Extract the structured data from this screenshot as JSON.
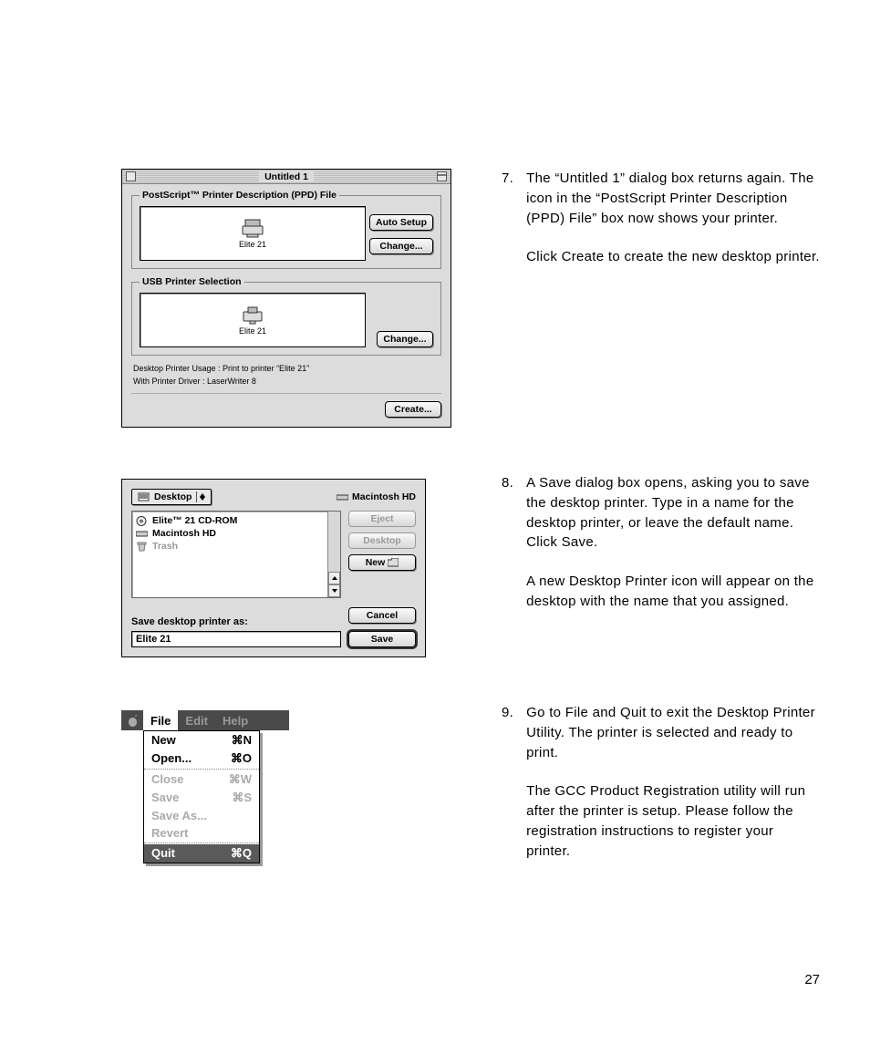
{
  "page_number": "27",
  "steps": [
    {
      "num": "7.",
      "paras": [
        "The “Untitled 1” dialog box returns again. The icon in the “PostScript Printer Description (PPD) File” box now shows your printer.",
        "Click Create to create the new desktop printer."
      ]
    },
    {
      "num": "8.",
      "paras": [
        "A Save dialog box opens, asking you to save the desktop printer. Type in a name for the desktop printer, or leave the default name. Click Save.",
        "A new Desktop Printer icon will appear on the desktop with the name that you assigned."
      ]
    },
    {
      "num": "9.",
      "paras": [
        "Go to File and Quit to exit the Desktop Printer Utility. The printer is selected and ready to print.",
        "The GCC Product Registration utility will run after the printer is setup. Please follow the registration instructions to register your printer."
      ]
    }
  ],
  "dlg1": {
    "title": "Untitled 1",
    "ppd_legend": "PostScript™ Printer Description (PPD) File",
    "ppd_device": "Elite 21",
    "auto_setup": "Auto Setup",
    "change": "Change...",
    "usb_legend": "USB Printer Selection",
    "usb_device": "Elite 21",
    "info1": "Desktop Printer Usage : Print to printer “Elite 21”",
    "info2": "With Printer Driver : LaserWriter 8",
    "create": "Create..."
  },
  "dlg2": {
    "popup": "Desktop",
    "volume": "Macintosh HD",
    "items": [
      {
        "label": "Elite™ 21 CD-ROM",
        "disabled": false,
        "icon": "cd"
      },
      {
        "label": "Macintosh HD",
        "disabled": false,
        "icon": "hd"
      },
      {
        "label": "Trash",
        "disabled": true,
        "icon": "trash"
      }
    ],
    "eject": "Eject",
    "desktop": "Desktop",
    "new": "New",
    "cancel": "Cancel",
    "save": "Save",
    "save_as_label": "Save desktop printer as:",
    "save_as_value": "Elite 21"
  },
  "menu": {
    "bar": {
      "file": "File",
      "edit": "Edit",
      "help": "Help"
    },
    "items": [
      {
        "label": "New",
        "short": "⌘N",
        "state": "normal"
      },
      {
        "label": "Open...",
        "short": "⌘O",
        "state": "normal"
      },
      {
        "sep": true
      },
      {
        "label": "Close",
        "short": "⌘W",
        "state": "disabled"
      },
      {
        "label": "Save",
        "short": "⌘S",
        "state": "disabled"
      },
      {
        "label": "Save As...",
        "short": "",
        "state": "disabled"
      },
      {
        "label": "Revert",
        "short": "",
        "state": "disabled"
      },
      {
        "sep": true
      },
      {
        "label": "Quit",
        "short": "⌘Q",
        "state": "hl"
      }
    ]
  }
}
